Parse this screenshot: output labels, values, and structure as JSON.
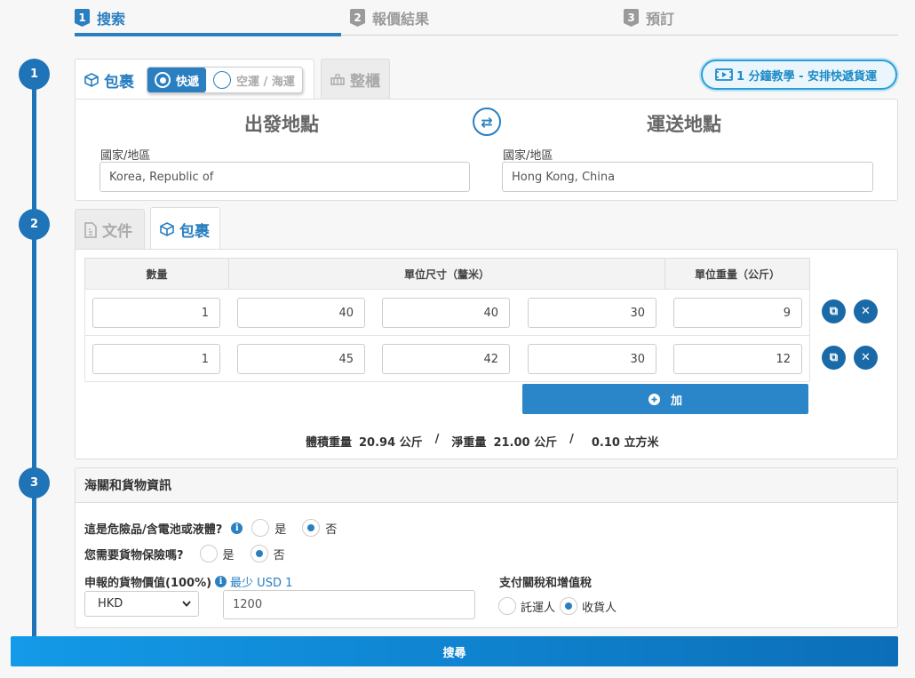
{
  "steps": [
    {
      "num": "1",
      "label": "搜索"
    },
    {
      "num": "2",
      "label": "報價結果"
    },
    {
      "num": "3",
      "label": "預訂"
    }
  ],
  "section_numbers": [
    "1",
    "2",
    "3"
  ],
  "shipment": {
    "tab_parcel": "包裹",
    "mode_express": "快遞",
    "mode_air_sea": "空運 / 海運",
    "tab_container": "整櫃",
    "tutorial": "1 分鐘教學 - 安排快遞貨運",
    "origin_title": "出發地點",
    "destination_title": "運送地點",
    "origin_label": "國家/地區",
    "origin_value": "Korea, Republic of",
    "destination_label": "國家/地區",
    "destination_value": "Hong Kong, China"
  },
  "cargo": {
    "tab_document": "文件",
    "tab_parcel": "包裹",
    "headers": {
      "qty": "數量",
      "dims": "單位尺寸（釐米）",
      "weight": "單位重量（公斤）"
    },
    "rows": [
      {
        "qty": "1",
        "l": "40",
        "w": "40",
        "h": "30",
        "weight": "9"
      },
      {
        "qty": "1",
        "l": "45",
        "w": "42",
        "h": "30",
        "weight": "12"
      }
    ],
    "add_label": "加",
    "summary": {
      "vol_label": "體積重量",
      "vol_value": "20.94 公斤",
      "net_label": "淨重量",
      "net_value": "21.00 公斤",
      "cbm_value": "0.10 立方米",
      "sep": "/"
    }
  },
  "customs": {
    "title": "海關和貨物資訊",
    "dangerous_q": "這是危險品/含電池或液體?",
    "yes": "是",
    "no": "否",
    "insurance_q": "您需要貨物保險嗎?",
    "declared_label": "申報的貨物價值(100%)",
    "min_note": "最少 USD 1",
    "currency": "HKD",
    "declared_value": "1200",
    "duties_label": "支付關稅和增值稅",
    "shipper": "託運人",
    "consignee": "收貨人"
  },
  "search_button": "搜尋",
  "colors": {
    "primary": "#2a7fc1",
    "dark": "#1f73b7"
  }
}
